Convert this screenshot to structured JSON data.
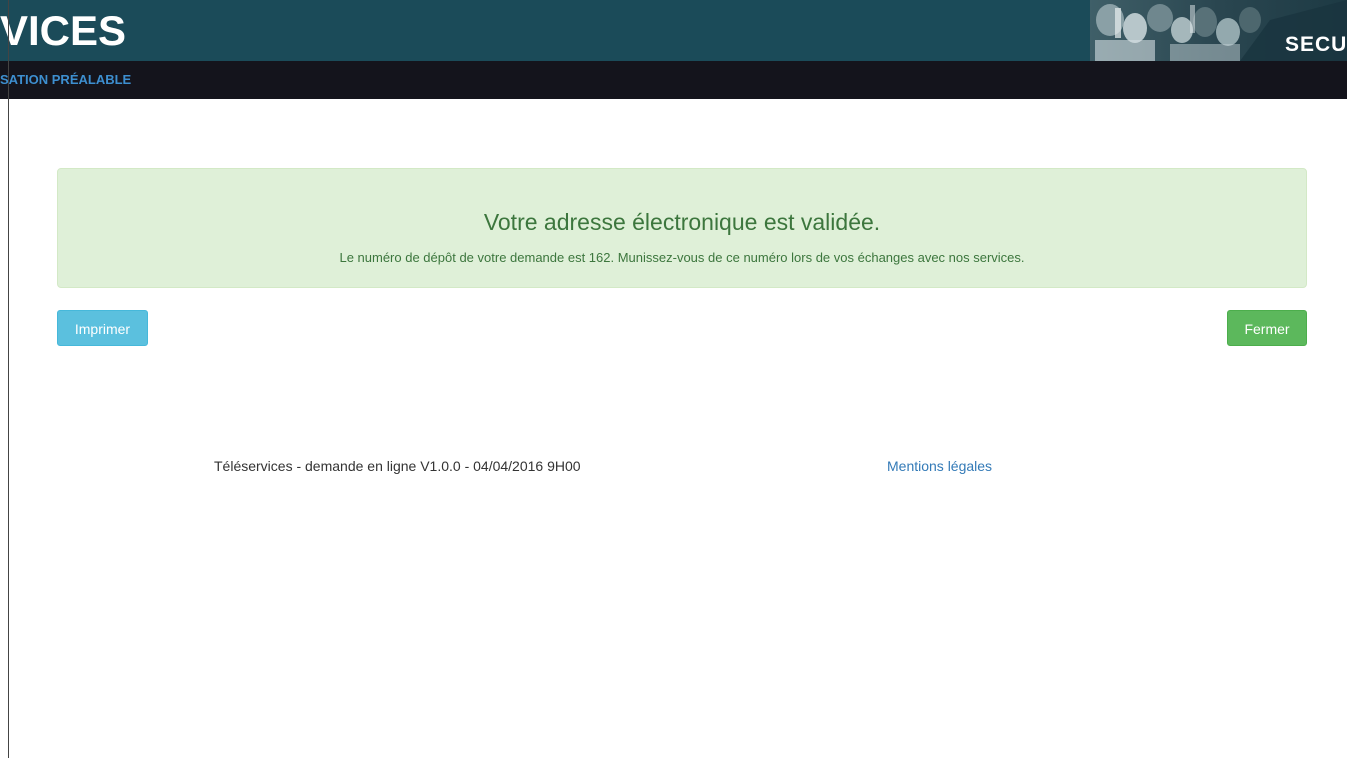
{
  "header": {
    "title": "VICES",
    "photo_label": "SECU",
    "photo_icon": "crowd-photo-icon",
    "background_color": "#1b4b59"
  },
  "navbar": {
    "link_label": "SATION PRÉALABLE",
    "background_color": "#14141c",
    "link_color": "#3d8fd0"
  },
  "alert": {
    "title": "Votre adresse électronique est validée.",
    "message": "Le numéro de dépôt de votre demande est 162. Munissez-vous de ce numéro lors de vos échanges avec nos services.",
    "background_color": "#dff0d8",
    "text_color": "#3c763d"
  },
  "buttons": {
    "print_label": "Imprimer",
    "close_label": "Fermer",
    "print_color": "#5bc0de",
    "close_color": "#5cb85c"
  },
  "footer": {
    "version_text": "Téléservices - demande en ligne V1.0.0 - 04/04/2016 9H00",
    "legal_link": "Mentions légales",
    "link_color": "#337ab7"
  }
}
